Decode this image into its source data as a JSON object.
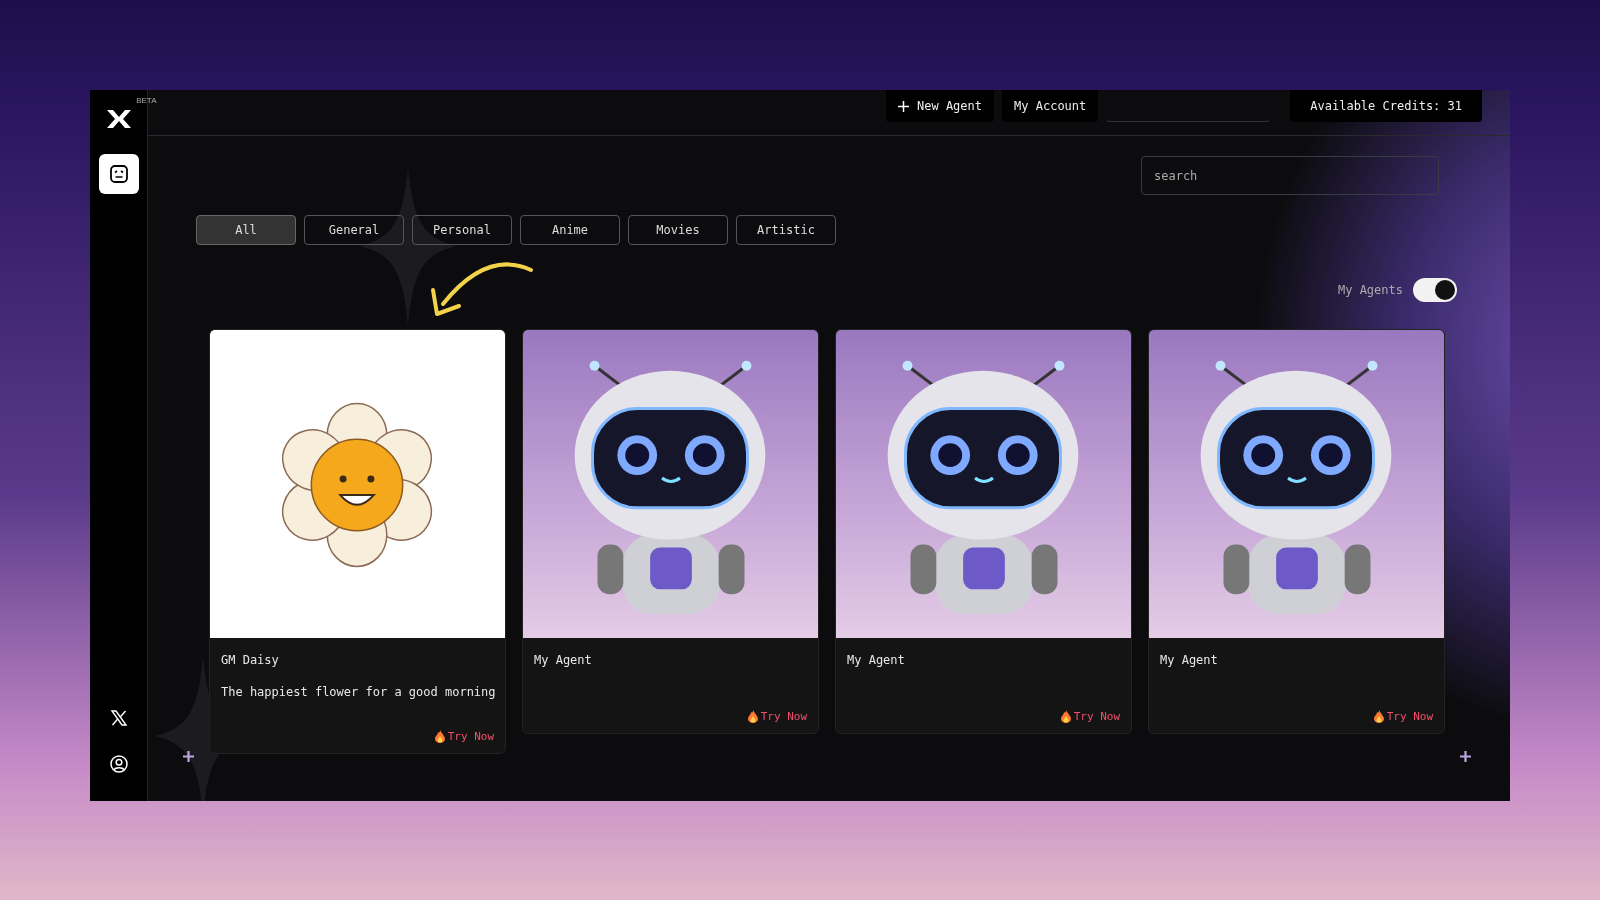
{
  "sidebar": {
    "badge": "BETA",
    "nav": [
      {
        "kind": "agents",
        "selected": true
      }
    ],
    "footer": [
      {
        "kind": "x"
      },
      {
        "kind": "profile"
      }
    ]
  },
  "header": {
    "buttons": [
      {
        "kind": "add",
        "label": "New Agent"
      },
      {
        "kind": "plain",
        "label": "My Account"
      },
      {
        "kind": "blank"
      }
    ],
    "credits": "Available Credits: 31"
  },
  "search": {
    "placeholder": "search"
  },
  "filters": [
    {
      "label": "All",
      "selected": true
    },
    {
      "label": "General",
      "selected": false
    },
    {
      "label": "Personal",
      "selected": false
    },
    {
      "label": "Anime",
      "selected": false
    },
    {
      "label": "Movies",
      "selected": false
    },
    {
      "label": "Artistic",
      "selected": false
    }
  ],
  "my_agents": {
    "label": "My Agents",
    "on": true
  },
  "cards": [
    {
      "kind": "flower",
      "title": "GM Daisy",
      "description": "The happiest flower for a good morning",
      "action": "Try Now"
    },
    {
      "kind": "robot",
      "title": "My Agent",
      "action": "Try Now"
    },
    {
      "kind": "robot",
      "title": "My Agent",
      "action": "Try Now"
    },
    {
      "kind": "robot",
      "title": "My Agent",
      "action": "Try Now"
    }
  ]
}
